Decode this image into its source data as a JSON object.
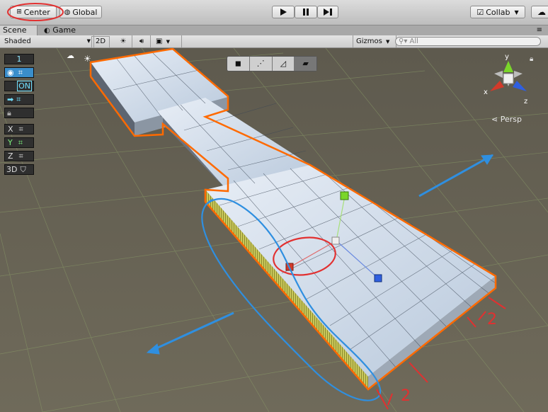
{
  "toolbar": {
    "center_label": "Center",
    "global_label": "Global",
    "collab_label": "Collab"
  },
  "tabs": [
    {
      "label": "Scene"
    },
    {
      "label": "Game"
    }
  ],
  "scene_toolbar": {
    "shading_mode": "Shaded",
    "mode_2d_label": "2D",
    "gizmos_label": "Gizmos",
    "search_placeholder": "All"
  },
  "viewport": {
    "persp_label": "Persp",
    "axis_labels": {
      "x": "x",
      "y": "y",
      "z": "z"
    },
    "annotations": [
      "2",
      "2"
    ]
  },
  "left_panel": {
    "layer_value": "1",
    "toggle_on_label": "ON",
    "axis_x": "X",
    "axis_y": "Y",
    "axis_z": "Z",
    "mode_3d": "3D"
  },
  "colors": {
    "selection_outline": "#ff6a00",
    "annotation_red": "#e23030",
    "annotation_blue": "#2f8fe0",
    "gizmo_x": "#d23a2a",
    "gizmo_y": "#7ad62a",
    "gizmo_z": "#2f5fe0",
    "grid_ground": "#6a6658"
  }
}
